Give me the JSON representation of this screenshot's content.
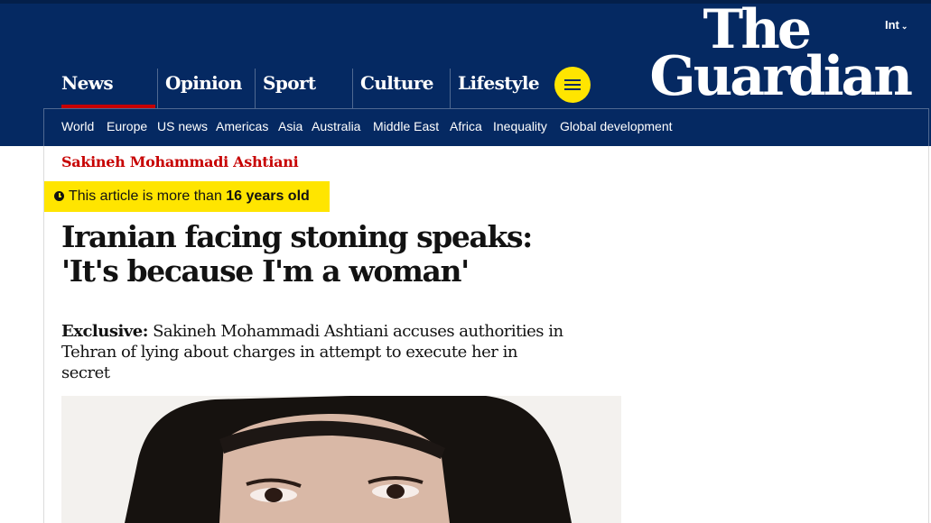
{
  "edition": {
    "label": "Int"
  },
  "logo": {
    "line1": "The",
    "line2": "Guardian"
  },
  "pillars": [
    {
      "label": "News"
    },
    {
      "label": "Opinion"
    },
    {
      "label": "Sport"
    },
    {
      "label": "Culture"
    },
    {
      "label": "Lifestyle"
    }
  ],
  "subnav": [
    "World",
    "Europe",
    "US news",
    "Americas",
    "Asia",
    "Australia",
    "Middle East",
    "Africa",
    "Inequality",
    "Global development"
  ],
  "article": {
    "kicker": "Sakineh Mohammadi Ashtiani",
    "age_prefix": "This article is more than ",
    "age_value": "16 years old",
    "headline": "Iranian facing stoning speaks: 'It's because I'm a woman'",
    "standfirst_label": "Exclusive:",
    "standfirst_text": " Sakineh Mohammadi Ashtiani accuses authorities in Tehran of lying about charges in attempt to execute her in secret"
  },
  "colors": {
    "brand_blue": "#052962",
    "news_red": "#c70000",
    "highlight_yellow": "#ffe500"
  },
  "icons": {
    "menu": "hamburger-icon",
    "clock": "clock-icon",
    "edition": "chevron-down-icon"
  }
}
